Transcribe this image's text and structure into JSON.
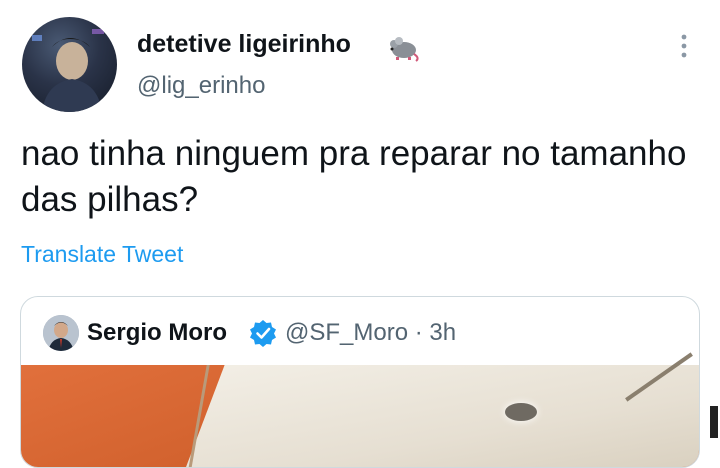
{
  "tweet": {
    "author": {
      "display_name": "detetive ligeirinho",
      "handle": "@lig_erinho",
      "name_emoji": "rat-icon"
    },
    "text": "nao tinha ninguem pra reparar no tamanho das pilhas?",
    "translate_label": "Translate Tweet",
    "menu_icon": "more-vertical-icon"
  },
  "quoted_tweet": {
    "display_name": "Sergio Moro",
    "verified_icon": "verified-badge-icon",
    "handle_time": "@SF_Moro · 3h"
  },
  "colors": {
    "link": "#1d9bf0",
    "secondary_text": "#536471",
    "border": "#cfd9de",
    "verified": "#1d9bf0"
  }
}
